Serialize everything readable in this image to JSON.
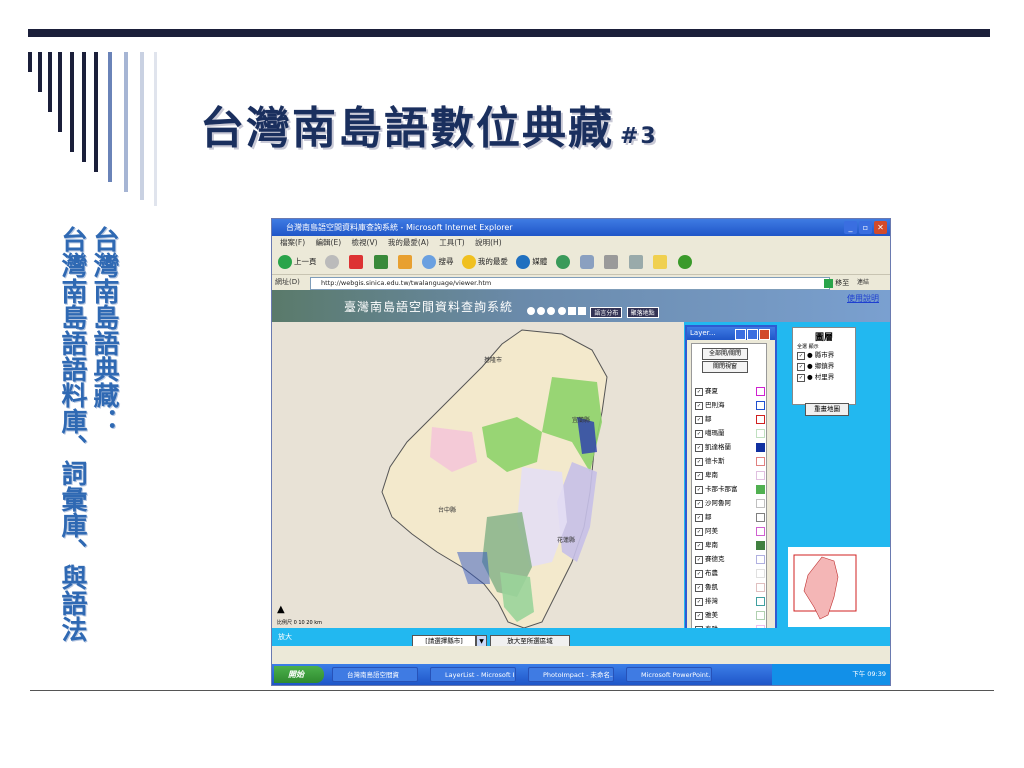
{
  "slide": {
    "title": "台灣南島語數位典藏",
    "title_num": "#3",
    "col_right": "台灣南島語典藏：",
    "col_left": "台灣南島語語料庫、詞彙庫、與語法"
  },
  "window": {
    "title": "台灣南島語空間資料庫查詢系統 - Microsoft Internet Explorer",
    "menu": [
      "檔案(F)",
      "編輯(E)",
      "檢視(V)",
      "我的最愛(A)",
      "工具(T)",
      "說明(H)"
    ],
    "toolbar": [
      "上一頁",
      "搜尋",
      "我的最愛",
      "媒體"
    ],
    "address_label": "網址(D)",
    "address": "http://webgis.sinica.edu.tw/twalanguage/viewer.htm",
    "go": "移至",
    "links": "連結"
  },
  "app": {
    "title": "臺灣南島語空間資料查詢系統",
    "help": "使用說明",
    "tool1": "語言分布",
    "tool2": "聚落地點",
    "zoom_label": "放大",
    "city_select": "[請選擇縣市]",
    "zoom_button": "放大至所選區域"
  },
  "legend": {
    "title": "圖層",
    "sub": "全選 顯示",
    "items": [
      "縣市界",
      "鄉鎮界",
      "村里界"
    ],
    "clear": "重畫地圖"
  },
  "layers": {
    "title": "Layer...",
    "btn_show_all": "全部開/關閉",
    "btn_close": "關閉視窗",
    "items": [
      {
        "name": "賽夏",
        "color": "#d020d0"
      },
      {
        "name": "巴則海",
        "color": "#2050d0"
      },
      {
        "name": "鄒",
        "color": "#d02020"
      },
      {
        "name": "噶瑪蘭",
        "color": "#c0e0c0"
      },
      {
        "name": "凱達格蘭",
        "color": "#1030a0"
      },
      {
        "name": "德卡斯",
        "color": "#e08080"
      },
      {
        "name": "卑南",
        "color": "#e0c0e0"
      },
      {
        "name": "卡那卡那富",
        "color": "#50b050"
      },
      {
        "name": "沙阿魯阿",
        "color": "#c0c0c0"
      },
      {
        "name": "鄒",
        "color": "#808080"
      },
      {
        "name": "阿美",
        "color": "#d060d0"
      },
      {
        "name": "卑南",
        "color": "#408040"
      },
      {
        "name": "賽德克",
        "color": "#b0b0e0"
      },
      {
        "name": "布農",
        "color": "#e0e0e0"
      },
      {
        "name": "魯凱",
        "color": "#e0c0c0"
      },
      {
        "name": "排灣",
        "color": "#40a0a0"
      },
      {
        "name": "雅美",
        "color": "#b0d0b0"
      },
      {
        "name": "泰雅",
        "color": "#f0c0f0"
      }
    ]
  },
  "taskbar": {
    "start": "開始",
    "tasks": [
      "台灣南島語空間資",
      "LayerList - Microsoft I...",
      "PhotoImpact - 未命名...",
      "Microsoft PowerPoint..."
    ],
    "clock": "下午 09:39"
  }
}
